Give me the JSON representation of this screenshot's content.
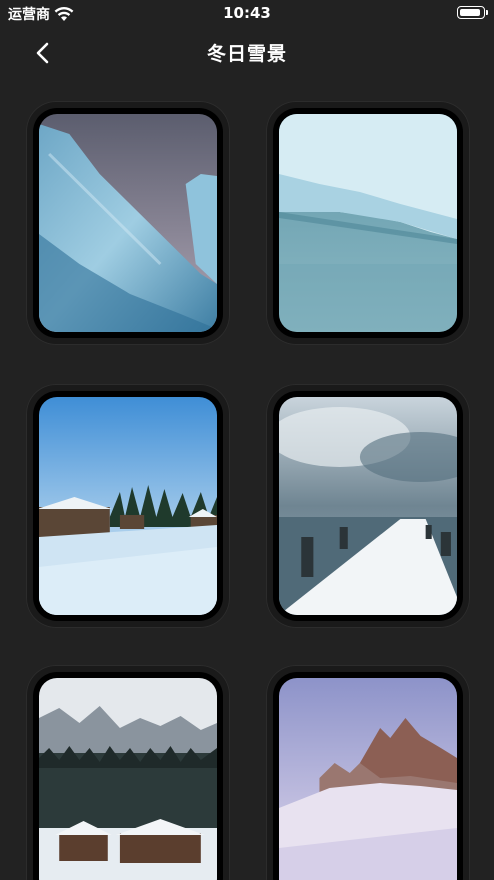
{
  "status_bar": {
    "carrier": "运营商",
    "time": "10:43",
    "battery_level": 0.95
  },
  "nav": {
    "title": "冬日雪景",
    "back_icon": "chevron-left-icon"
  },
  "gallery": [
    {
      "name": "ice-cliff"
    },
    {
      "name": "frozen-lake-ice"
    },
    {
      "name": "snowy-cabins-forest"
    },
    {
      "name": "snowy-pier"
    },
    {
      "name": "mountain-village"
    },
    {
      "name": "dolomite-peaks"
    }
  ],
  "colors": {
    "background": "#222222",
    "card": "#1a1a1a",
    "text": "#ffffff"
  }
}
